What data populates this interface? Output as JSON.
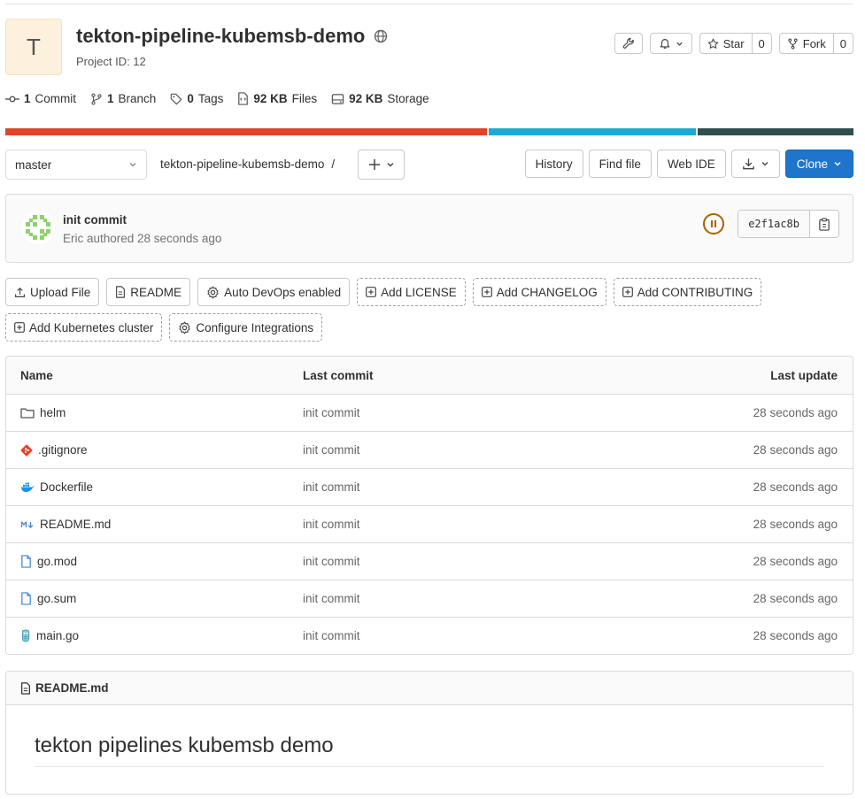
{
  "project": {
    "avatar_letter": "T",
    "name": "tekton-pipeline-kubemsb-demo",
    "visibility_icon": "globe-icon",
    "id_text": "Project ID: 12"
  },
  "header_actions": {
    "settings_icon": "wrench-icon",
    "notification_icon": "bell-icon",
    "star_label": "Star",
    "star_count": "0",
    "fork_label": "Fork",
    "fork_count": "0"
  },
  "stats": [
    {
      "icon": "commit-icon",
      "value": "1",
      "label": "Commit"
    },
    {
      "icon": "branch-icon",
      "value": "1",
      "label": "Branch"
    },
    {
      "icon": "tag-icon",
      "value": "0",
      "label": "Tags"
    },
    {
      "icon": "file-icon",
      "value": "92 KB",
      "label": "Files"
    },
    {
      "icon": "storage-icon",
      "value": "92 KB",
      "label": "Storage"
    }
  ],
  "languages": [
    {
      "color": "#e24329",
      "share": 57
    },
    {
      "color": "#1aaad4",
      "share": 24.5
    },
    {
      "color": "#2f4f4f",
      "share": 18.5
    }
  ],
  "toolbar": {
    "branch": "master",
    "breadcrumb_repo": "tekton-pipeline-kubemsb-demo",
    "breadcrumb_sep": "/",
    "history": "History",
    "find_file": "Find file",
    "web_ide": "Web IDE",
    "clone": "Clone"
  },
  "last_commit": {
    "title": "init commit",
    "meta": "Eric authored 28 seconds ago",
    "sha": "e2f1ac8b",
    "pipeline_status": "paused"
  },
  "quick_actions": {
    "upload_file": "Upload File",
    "readme": "README",
    "auto_devops": "Auto DevOps enabled",
    "add_license": "Add LICENSE",
    "add_changelog": "Add CHANGELOG",
    "add_contributing": "Add CONTRIBUTING",
    "add_k8s": "Add Kubernetes cluster",
    "configure_integrations": "Configure Integrations"
  },
  "file_table": {
    "headers": {
      "name": "Name",
      "last_commit": "Last commit",
      "last_update": "Last update"
    },
    "rows": [
      {
        "icon": "folder-icon",
        "name": "helm",
        "commit": "init commit",
        "updated": "28 seconds ago"
      },
      {
        "icon": "git-icon",
        "name": ".gitignore",
        "commit": "init commit",
        "updated": "28 seconds ago"
      },
      {
        "icon": "docker-icon",
        "name": "Dockerfile",
        "commit": "init commit",
        "updated": "28 seconds ago"
      },
      {
        "icon": "markdown-icon",
        "name": "README.md",
        "commit": "init commit",
        "updated": "28 seconds ago"
      },
      {
        "icon": "file-icon",
        "name": "go.mod",
        "commit": "init commit",
        "updated": "28 seconds ago"
      },
      {
        "icon": "file-icon",
        "name": "go.sum",
        "commit": "init commit",
        "updated": "28 seconds ago"
      },
      {
        "icon": "go-icon",
        "name": "main.go",
        "commit": "init commit",
        "updated": "28 seconds ago"
      }
    ]
  },
  "readme": {
    "filename": "README.md",
    "heading": "tekton pipelines kubemsb demo"
  }
}
